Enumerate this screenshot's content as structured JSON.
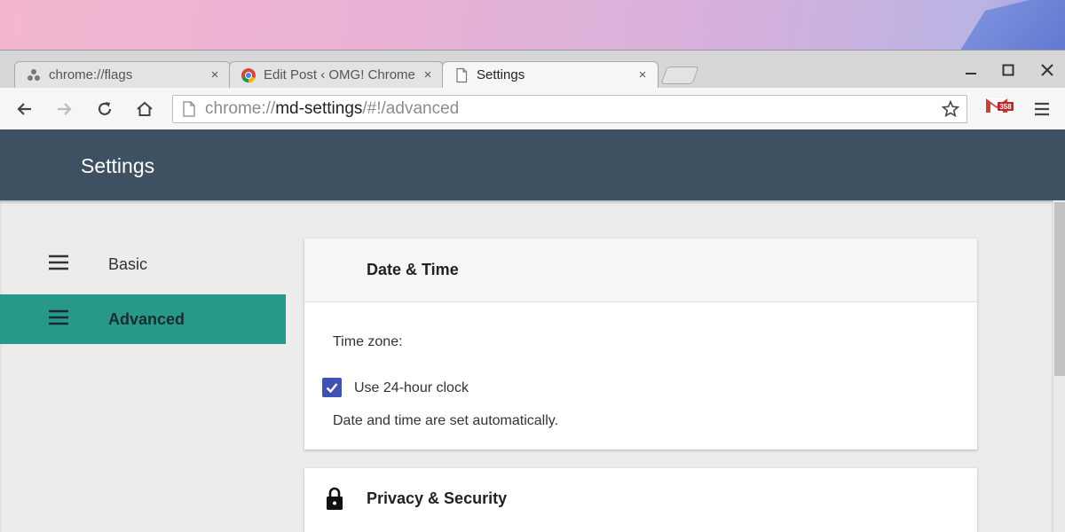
{
  "tabs": [
    {
      "title": "chrome://flags",
      "icon": "flask-icon",
      "close": "×"
    },
    {
      "title": "Edit Post ‹ OMG! Chrome",
      "icon": "chrome-logo-icon",
      "close": "×"
    },
    {
      "title": "Settings",
      "icon": "page-icon",
      "close": "×"
    }
  ],
  "window_controls": {
    "minimize": "—",
    "maximize": "☐",
    "close": "✕"
  },
  "omnibox": {
    "scheme": "chrome://",
    "host": "md-settings",
    "path": "/#!/advanced"
  },
  "extension": {
    "badge": "358"
  },
  "header": {
    "title": "Settings"
  },
  "nav": [
    {
      "label": "Basic",
      "selected": false
    },
    {
      "label": "Advanced",
      "selected": true
    }
  ],
  "date_time_card": {
    "title": "Date & Time",
    "time_zone_label": "Time zone:",
    "clock_label": "Use 24-hour clock",
    "clock_checked": true,
    "auto_text": "Date and time are set automatically."
  },
  "privacy_card": {
    "title": "Privacy & Security"
  },
  "colors": {
    "header": "#3e5162",
    "accent": "#26998a",
    "checkbox": "#3f51b5"
  }
}
